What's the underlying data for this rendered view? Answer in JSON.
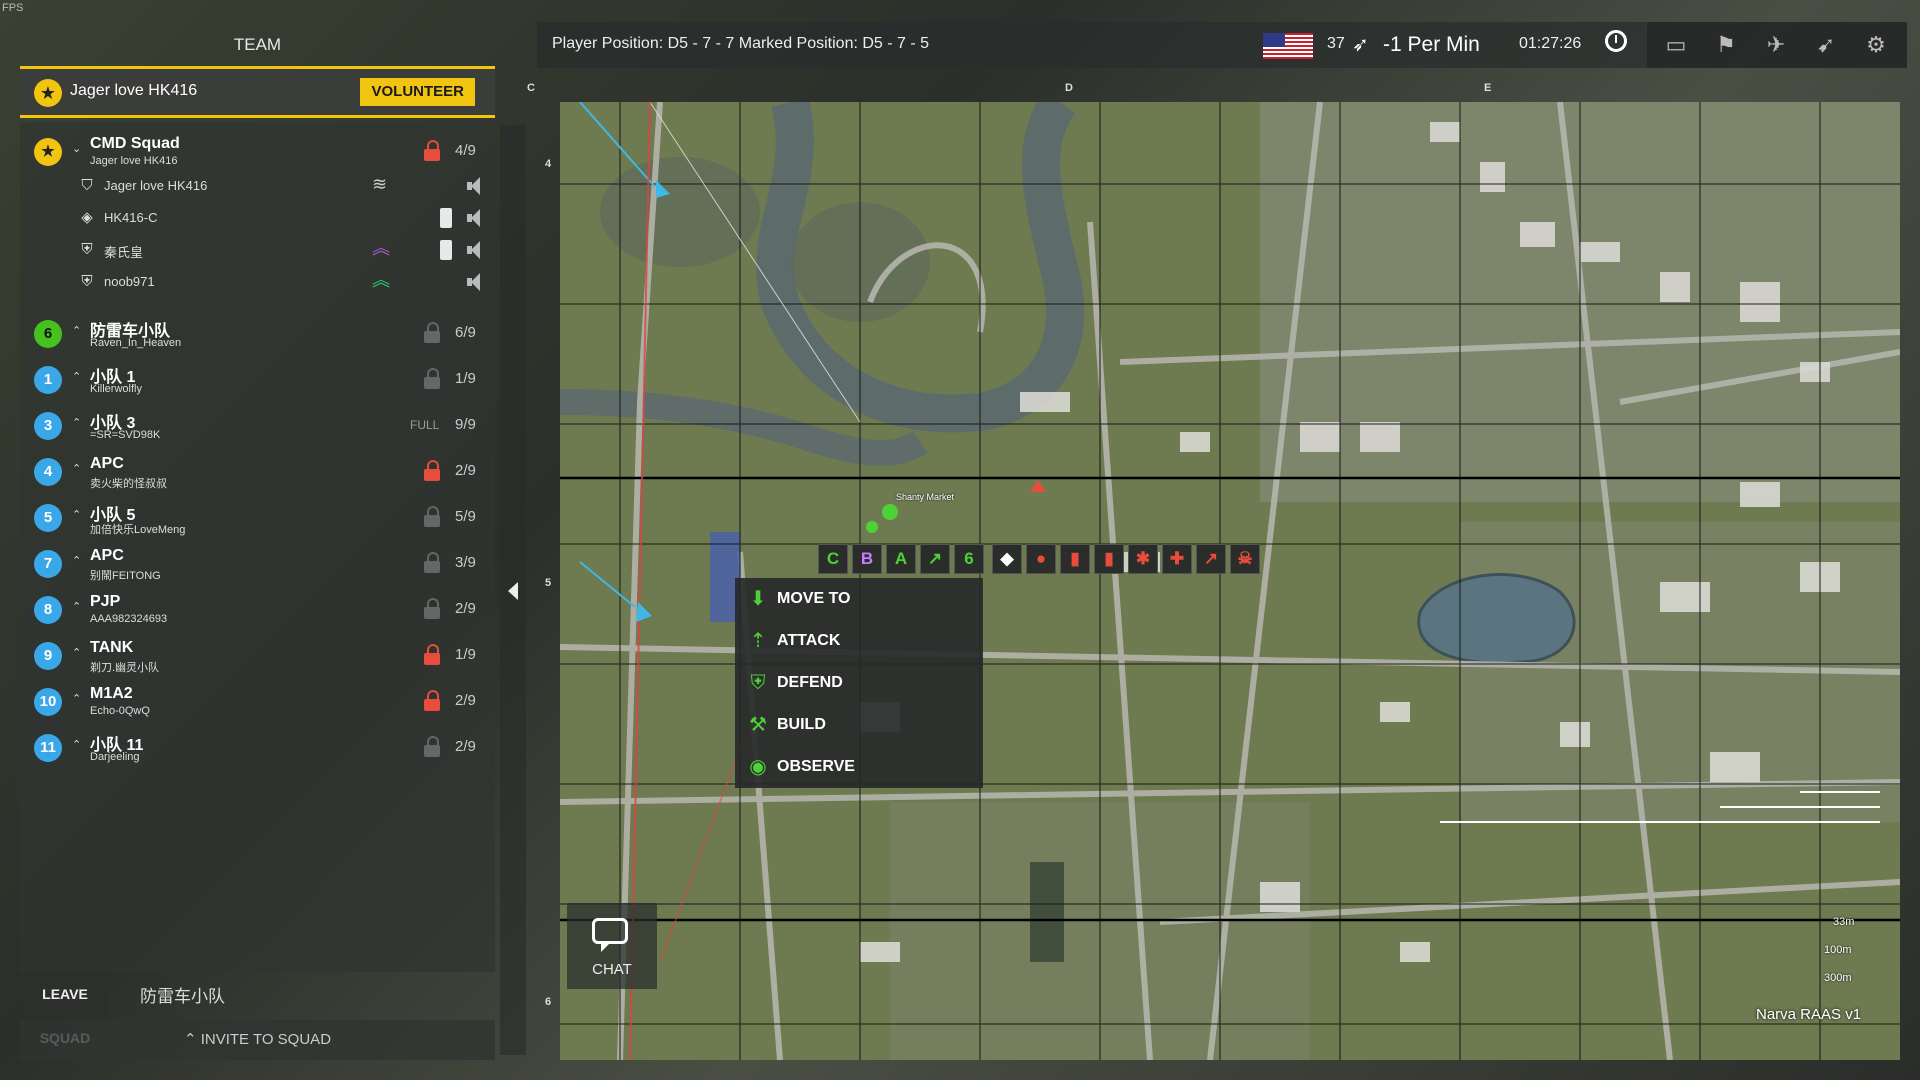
{
  "fps": "FPS",
  "team": {
    "title": "TEAM",
    "leader_name": "Jager love HK416",
    "volunteer_label": "VOLUNTEER"
  },
  "squads": [
    {
      "num": "★",
      "name": "CMD Squad",
      "leader": "Jager love HK416",
      "count": "4/9",
      "lock": "red",
      "color": "gold",
      "expanded": true,
      "members": [
        {
          "name": "Jager love HK416",
          "icon": "shield-icon",
          "rank": "chevron-stack-icon",
          "rank_color": "#cccccc",
          "kit": false
        },
        {
          "name": "HK416-C",
          "icon": "diamond-shield-icon",
          "rank": "",
          "rank_color": "",
          "kit": true
        },
        {
          "name": "秦氏皇",
          "icon": "medic-shield-icon",
          "rank": "double-chevron-icon",
          "rank_color": "#b05cd6",
          "kit": true
        },
        {
          "name": "noob971",
          "icon": "medic-shield-icon",
          "rank": "double-chevron-icon",
          "rank_color": "#2ecc71",
          "kit": false
        }
      ]
    },
    {
      "num": "6",
      "name": "防雷车小队",
      "leader": "Raven_In_Heaven",
      "count": "6/9",
      "lock": "grey",
      "color": "green"
    },
    {
      "num": "1",
      "name": "小队 1",
      "leader": "Killerwolfly",
      "count": "1/9",
      "lock": "grey",
      "color": "blue"
    },
    {
      "num": "3",
      "name": "小队 3",
      "leader": "=SR=SVD98K",
      "count": "9/9",
      "lock": "none",
      "full": "FULL",
      "color": "blue"
    },
    {
      "num": "4",
      "name": "APC",
      "leader": "卖火柴的怪叔叔",
      "count": "2/9",
      "lock": "red",
      "color": "blue"
    },
    {
      "num": "5",
      "name": "小队 5",
      "leader": "加倍快乐LoveMeng",
      "count": "5/9",
      "lock": "grey",
      "color": "blue"
    },
    {
      "num": "7",
      "name": "APC",
      "leader": "别鬧FEITONG",
      "count": "3/9",
      "lock": "grey",
      "color": "blue"
    },
    {
      "num": "8",
      "name": "PJP",
      "leader": "AAA982324693",
      "count": "2/9",
      "lock": "grey",
      "color": "blue"
    },
    {
      "num": "9",
      "name": "TANK",
      "leader": "剃刀.幽灵小队",
      "count": "1/9",
      "lock": "red",
      "color": "blue"
    },
    {
      "num": "10",
      "name": "M1A2",
      "leader": "Echo-0QwQ",
      "count": "2/9",
      "lock": "red",
      "color": "blue"
    },
    {
      "num": "11",
      "name": "小队 11",
      "leader": "Darjeeling",
      "count": "2/9",
      "lock": "grey",
      "color": "blue"
    }
  ],
  "footer": {
    "leave_label": "LEAVE SQUAD",
    "current_squad": "防雷车小队",
    "invite_label": "INVITE TO SQUAD"
  },
  "topbar": {
    "position_text": "Player Position: D5 - 7 - 7   Marked Position: D5 - 7 - 5",
    "tickets": "37",
    "rate": "-1 Per Min",
    "clock": "01:27:26",
    "icons": [
      "chat-bubble-icon",
      "squad-help-icon",
      "vehicle-help-icon",
      "rocket-help-icon",
      "gear-icon"
    ]
  },
  "map": {
    "columns": [
      "C",
      "D",
      "E"
    ],
    "rows": [
      "4",
      "5",
      "6"
    ],
    "place_label": "Shanty Market",
    "name": "Narva RAAS v1",
    "scale": [
      "33m",
      "100m",
      "300m"
    ]
  },
  "markers": [
    {
      "label": "C",
      "color": "#4cd137"
    },
    {
      "label": "B",
      "color": "#c77dff"
    },
    {
      "label": "A",
      "color": "#4cd137"
    },
    {
      "label": "↗",
      "color": "#4cd137"
    },
    {
      "label": "6",
      "color": "#4cd137"
    },
    {
      "label": "◆",
      "color": "#ffffff"
    },
    {
      "label": "●",
      "color": "#e74c3c"
    },
    {
      "label": "▮",
      "color": "#e74c3c"
    },
    {
      "label": "▮",
      "color": "#e74c3c"
    },
    {
      "label": "✱",
      "color": "#e74c3c"
    },
    {
      "label": "✚",
      "color": "#e74c3c"
    },
    {
      "label": "↗",
      "color": "#e74c3c"
    },
    {
      "label": "☠",
      "color": "#e74c3c"
    }
  ],
  "context_menu": [
    {
      "label": "MOVE TO",
      "icon": "move-arrow-icon"
    },
    {
      "label": "ATTACK",
      "icon": "attack-icon"
    },
    {
      "label": "DEFEND",
      "icon": "defend-shield-icon"
    },
    {
      "label": "BUILD",
      "icon": "build-icon"
    },
    {
      "label": "OBSERVE",
      "icon": "eye-icon"
    }
  ],
  "chat": {
    "label": "CHAT"
  }
}
